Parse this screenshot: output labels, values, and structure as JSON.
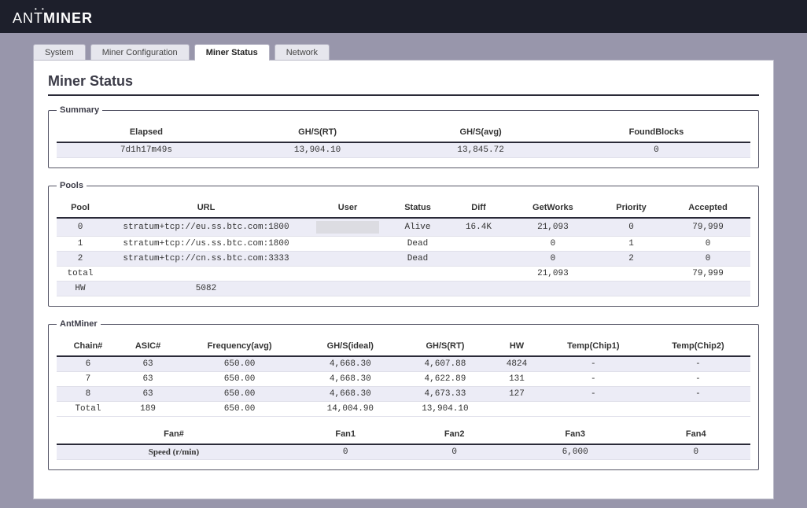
{
  "brand": {
    "thin": "ANT",
    "bold": "MINER"
  },
  "tabs": {
    "system": "System",
    "miner_config": "Miner Configuration",
    "miner_status": "Miner Status",
    "network": "Network"
  },
  "page_title": "Miner Status",
  "summary": {
    "legend": "Summary",
    "headers": {
      "elapsed": "Elapsed",
      "ghs_rt": "GH/S(RT)",
      "ghs_avg": "GH/S(avg)",
      "found": "FoundBlocks"
    },
    "row": {
      "elapsed": "7d1h17m49s",
      "ghs_rt": "13,904.10",
      "ghs_avg": "13,845.72",
      "found": "0"
    }
  },
  "pools": {
    "legend": "Pools",
    "headers": {
      "pool": "Pool",
      "url": "URL",
      "user": "User",
      "status": "Status",
      "diff": "Diff",
      "getworks": "GetWorks",
      "priority": "Priority",
      "accepted": "Accepted"
    },
    "rows": [
      {
        "pool": "0",
        "url": "stratum+tcp://eu.ss.btc.com:1800",
        "user": "",
        "status": "Alive",
        "diff": "16.4K",
        "getworks": "21,093",
        "priority": "0",
        "accepted": "79,999"
      },
      {
        "pool": "1",
        "url": "stratum+tcp://us.ss.btc.com:1800",
        "user": "",
        "status": "Dead",
        "diff": "",
        "getworks": "0",
        "priority": "1",
        "accepted": "0"
      },
      {
        "pool": "2",
        "url": "stratum+tcp://cn.ss.btc.com:3333",
        "user": "",
        "status": "Dead",
        "diff": "",
        "getworks": "0",
        "priority": "2",
        "accepted": "0"
      }
    ],
    "total_label": "total",
    "total": {
      "getworks": "21,093",
      "accepted": "79,999"
    },
    "hw_label": "HW",
    "hw_value": "5082"
  },
  "antminer": {
    "legend": "AntMiner",
    "headers": {
      "chain": "Chain#",
      "asic": "ASIC#",
      "freq": "Frequency(avg)",
      "ghs_ideal": "GH/S(ideal)",
      "ghs_rt": "GH/S(RT)",
      "hw": "HW",
      "temp1": "Temp(Chip1)",
      "temp2": "Temp(Chip2)"
    },
    "rows": [
      {
        "chain": "6",
        "asic": "63",
        "freq": "650.00",
        "ghs_ideal": "4,668.30",
        "ghs_rt": "4,607.88",
        "hw": "4824",
        "temp1": "-",
        "temp2": "-"
      },
      {
        "chain": "7",
        "asic": "63",
        "freq": "650.00",
        "ghs_ideal": "4,668.30",
        "ghs_rt": "4,622.89",
        "hw": "131",
        "temp1": "-",
        "temp2": "-"
      },
      {
        "chain": "8",
        "asic": "63",
        "freq": "650.00",
        "ghs_ideal": "4,668.30",
        "ghs_rt": "4,673.33",
        "hw": "127",
        "temp1": "-",
        "temp2": "-"
      }
    ],
    "total_label": "Total",
    "total": {
      "asic": "189",
      "freq": "650.00",
      "ghs_ideal": "14,004.90",
      "ghs_rt": "13,904.10"
    },
    "fans": {
      "headers": {
        "fan": "Fan#",
        "fan1": "Fan1",
        "fan2": "Fan2",
        "fan3": "Fan3",
        "fan4": "Fan4"
      },
      "speed_label": "Speed (r/min)",
      "values": {
        "fan1": "0",
        "fan2": "0",
        "fan3": "6,000",
        "fan4": "0"
      }
    }
  }
}
